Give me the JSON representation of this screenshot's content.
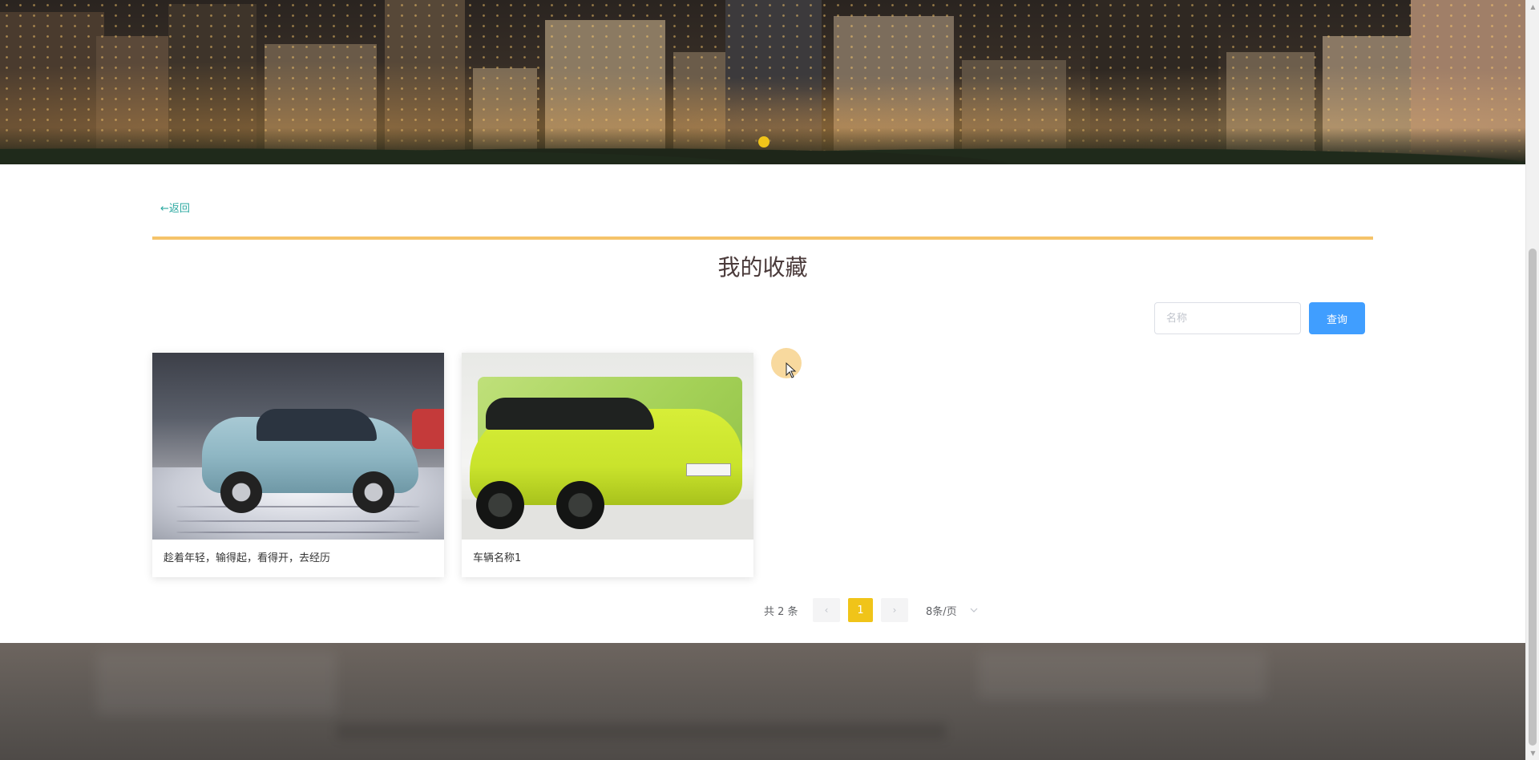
{
  "nav": {
    "back_label": "←返回"
  },
  "page": {
    "title": "我的收藏"
  },
  "search": {
    "placeholder": "名称",
    "button_label": "查询"
  },
  "cards": [
    {
      "caption": "趁着年轻，输得起，看得开，去经历"
    },
    {
      "caption": "车辆名称1"
    }
  ],
  "pagination": {
    "total_label": "共 2 条",
    "prev_icon": "‹",
    "next_icon": "›",
    "current_page": "1",
    "page_size_label": "8条/页",
    "dropdown_icon": "chevron-down-icon"
  },
  "colors": {
    "accent_yellow": "#f0c419",
    "divider": "#f5c36a",
    "primary_button": "#409eff",
    "back_link": "#2aa8a0"
  }
}
